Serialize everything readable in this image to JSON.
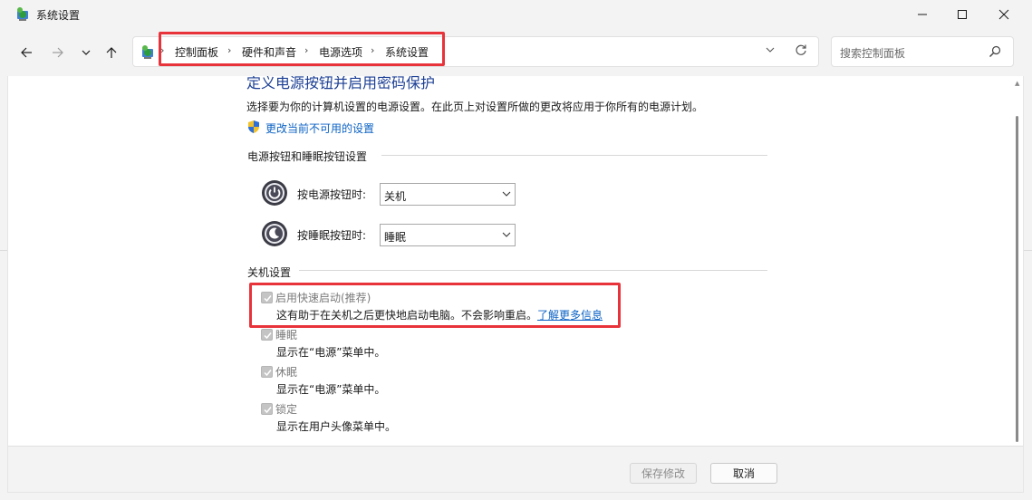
{
  "window": {
    "title": "系统设置"
  },
  "address": {
    "breadcrumbs": [
      "控制面板",
      "硬件和声音",
      "电源选项",
      "系统设置"
    ]
  },
  "search": {
    "placeholder": "搜索控制面板"
  },
  "page": {
    "heading": "定义电源按钮并启用密码保护",
    "description": "选择要为你的计算机设置的电源设置。在此页上对设置所做的更改将应用于你所有的电源计划。",
    "change_link": "更改当前不可用的设置"
  },
  "power_section": {
    "title": "电源按钮和睡眠按钮设置",
    "power_button": {
      "label": "按电源按钮时:",
      "value": "关机"
    },
    "sleep_button": {
      "label": "按睡眠按钮时:",
      "value": "睡眠"
    }
  },
  "shutdown_section": {
    "title": "关机设置",
    "items": [
      {
        "label": "启用快速启动(推荐)",
        "desc": "这有助于在关机之后更快地启动电脑。不会影响重启。",
        "link": "了解更多信息",
        "checked": true
      },
      {
        "label": "睡眠",
        "desc": "显示在“电源”菜单中。",
        "checked": true
      },
      {
        "label": "休眠",
        "desc": "显示在“电源”菜单中。",
        "checked": true
      },
      {
        "label": "锁定",
        "desc": "显示在用户头像菜单中。",
        "checked": true
      }
    ]
  },
  "footer": {
    "save_label": "保存修改",
    "cancel_label": "取消"
  },
  "colors": {
    "highlight": "#e8333a",
    "link": "#0b62c4",
    "heading": "#1c3f94"
  }
}
